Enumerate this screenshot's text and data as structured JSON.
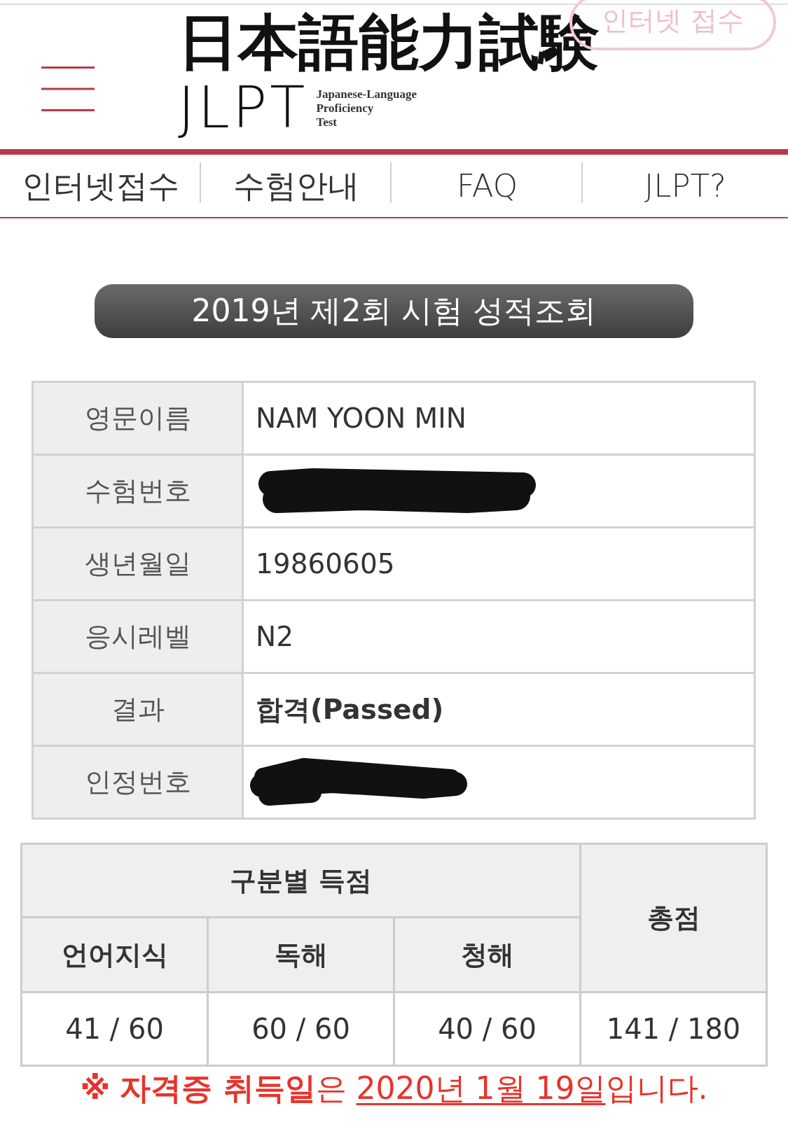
{
  "header": {
    "logo": {
      "title": "日本語能力試験",
      "acronym": "JLPT",
      "subtitle_lines": [
        "Japanese-Language",
        "Proficiency",
        "Test"
      ]
    },
    "apply_button": {
      "label": "인터넷 접수"
    }
  },
  "nav": [
    {
      "label": "인터넷접수"
    },
    {
      "label": "수험안내"
    },
    {
      "label": "FAQ"
    },
    {
      "label": "JLPT?"
    }
  ],
  "page_title": "2019년 제2회 시험 성적조회",
  "info_table": {
    "rows": [
      {
        "label": "영문이름",
        "kind": "plain",
        "value": "NAM YOON MIN"
      },
      {
        "label": "수험번호",
        "kind": "redacted"
      },
      {
        "label": "생년월일",
        "kind": "plain",
        "value": "19860605"
      },
      {
        "label": "응시레벨",
        "kind": "plain",
        "value": "N2"
      },
      {
        "label": "결과",
        "kind": "strong",
        "value": "합격(Passed)"
      },
      {
        "label": "인정번호",
        "kind": "redacted"
      }
    ]
  },
  "score_table": {
    "group_header": "구분별 득점",
    "total_header": "총점",
    "sections": [
      {
        "label": "언어지식",
        "score": "41 / 60"
      },
      {
        "label": "독해",
        "score": "60 / 60"
      },
      {
        "label": "청해",
        "score": "40 / 60"
      }
    ],
    "total": "141 / 180"
  },
  "notice": {
    "mark": "※",
    "parts": [
      {
        "kind": "bold",
        "text": "자격증 취득일"
      },
      {
        "kind": "plain",
        "text": "은 "
      },
      {
        "kind": "underline",
        "text": "2020년 1월 19일"
      },
      {
        "kind": "plain",
        "text": "입니다."
      }
    ]
  }
}
